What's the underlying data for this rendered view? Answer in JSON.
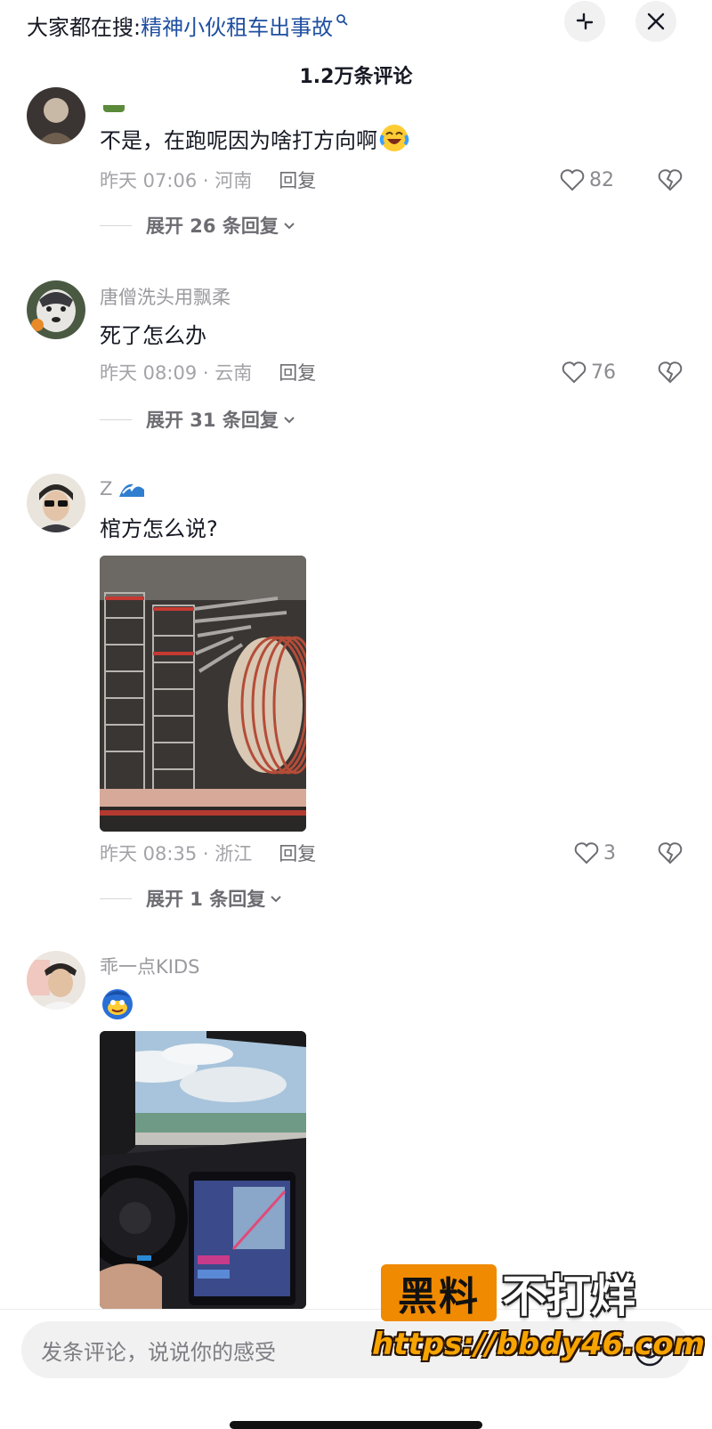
{
  "header": {
    "search_prefix": "大家都在搜:",
    "search_query": "精神小伙租车出事故",
    "search_icon": "search-icon",
    "collapse_icon": "collapse-icon",
    "close_icon": "close-icon",
    "comment_count_title": "1.2万条评论"
  },
  "comments": [
    {
      "username": "",
      "text": "不是，在跑呢因为啥打方向啊",
      "emoji": "laugh-cry-emoji",
      "time_location": "昨天 07:06 · 河南",
      "reply_label": "回复",
      "likes": "82",
      "expand_label": "展开 26 条回复"
    },
    {
      "username": "唐僧洗头用飘柔",
      "text": "死了怎么办",
      "time_location": "昨天 08:09 · 云南",
      "reply_label": "回复",
      "likes": "76",
      "expand_label": "展开 31 条回复"
    },
    {
      "username": "Z",
      "text": "棺方怎么说?",
      "image": "truck-cargo-photo",
      "time_location": "昨天 08:35 · 浙江",
      "reply_label": "回复",
      "likes": "3",
      "expand_label": "展开 1 条回复"
    },
    {
      "username": "乖一点KIDS",
      "emoji": "blue-face-emoji",
      "image": "car-interior-photo"
    }
  ],
  "composer": {
    "placeholder": "发条评论，说说你的感受"
  },
  "watermark": {
    "badge": "黑料",
    "tagline": "不打烊",
    "url": "https://bbdy46.com"
  },
  "colors": {
    "link_blue": "#1f4fa0",
    "muted_text": "#a3a3a8",
    "watermark_orange": "#f08a00"
  }
}
